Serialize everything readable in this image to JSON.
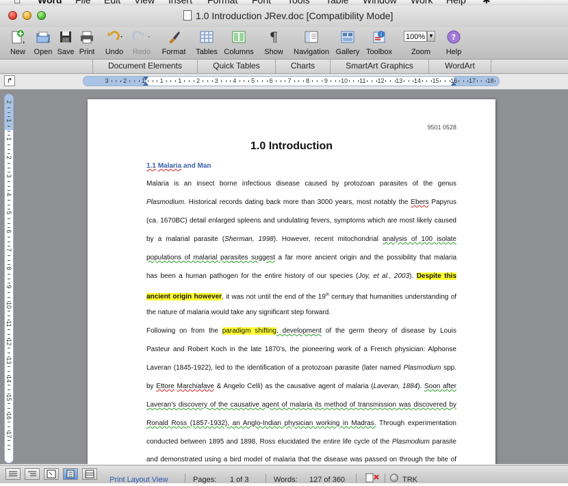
{
  "menubar": {
    "app": "Word",
    "items": [
      "File",
      "Edit",
      "View",
      "Insert",
      "Format",
      "Font",
      "Tools",
      "Table",
      "Window",
      "Work",
      "Help"
    ]
  },
  "window": {
    "title": "1.0 Introduction JRev.doc [Compatibility Mode]"
  },
  "toolbar": {
    "new": "New",
    "open": "Open",
    "save": "Save",
    "print": "Print",
    "undo": "Undo",
    "redo": "Redo",
    "format": "Format",
    "tables": "Tables",
    "columns": "Columns",
    "show": "Show",
    "navigation": "Navigation",
    "gallery": "Gallery",
    "toolbox": "Toolbox",
    "zoom": "Zoom",
    "zoom_value": "100%",
    "help": "Help"
  },
  "ribbon": {
    "tabs": [
      "Document Elements",
      "Quick Tables",
      "Charts",
      "SmartArt Graphics",
      "WordArt"
    ]
  },
  "ruler": {
    "numbers": [
      "3",
      "2",
      "1",
      "1",
      "1",
      "2",
      "3",
      "4",
      "5",
      "6",
      "7",
      "8",
      "9",
      "10",
      "11",
      "12",
      "13",
      "14",
      "15",
      "16",
      "17",
      "18"
    ]
  },
  "vruler": {
    "numbers": [
      "2",
      "1",
      "1",
      "2",
      "3",
      "4",
      "5",
      "6",
      "7",
      "8",
      "9",
      "10",
      "11",
      "12",
      "13",
      "14",
      "15",
      "16",
      "17"
    ]
  },
  "document": {
    "page_number": "9501 0528",
    "heading": "1.0 Introduction",
    "subheading_num": "1.1",
    "subheading_word1": "Malaria",
    "subheading_rest": " and Man",
    "p1": {
      "l1": "Malaria is an insect borne infectious disease caused by protozoan parasites of the genus",
      "l2_i": "Plasmodium",
      "l2_a": ".  Historical records dating back more than 3000 years, most notably the ",
      "l2_sp": "Ebers",
      "l2_b": " Papyrus",
      "l3": "(ca. 1670BC) detail enlarged spleens and undulating fevers, symptoms which are most likely caused",
      "l4_a": "by a malarial parasite (",
      "l4_i": "Sherman, 1998",
      "l4_b": ").  However, recent mitochondrial ",
      "l4_gr": "analysis of 100 isolate",
      "l5_gr": "populations of malarial parasites suggest",
      "l5_b": " a far more ancient origin and the possibility that malaria",
      "l6_a": "has been a human pathogen for the entire history of our species (",
      "l6_i": "Joy, et al., 2003",
      "l6_b": ").  ",
      "l6_hl": "Despite this",
      "l7_hl": "ancient origin however",
      "l7_a": ", it was not until the end of the 19",
      "l7_sup": "th",
      "l7_b": " century that humanities understanding of",
      "l8": "the nature of malaria would take any significant step forward."
    },
    "p2": {
      "l1_a": "Following on from the ",
      "l1_hl": "paradigm shifting",
      "l1_gr": ", development",
      "l1_b": " of the germ theory of disease by Louis",
      "l2": "Pasteur and Robert Koch in the late 1870’s, the pioneering work of a French physician: Alphonse",
      "l3_a": "Laveran (1845-1922), led to the identification of a protozoan parasite (later named ",
      "l3_i": "Plasmodium",
      "l3_b": " spp.",
      "l4_a": "by ",
      "l4_sp1": "Ettore",
      "l4_s": " ",
      "l4_sp2": "Marchiafave",
      "l4_b": " & Angelo Celli) as the causative agent of malaria (",
      "l4_i": "Laveran, 1884",
      "l4_c": ").  ",
      "l4_gr": "Soon after",
      "l5_gr": "Laveran’s discovery of the causative agent of malaria its method of transmission was discovered by",
      "l6_gr": "Ronald Ross (1857-1932), an Anglo-Indian physician working in Madras.",
      "l6_b": "  Through experimentation",
      "l7_a": "conducted between 1895 and 1898, Ross elucidated the entire life cycle of the ",
      "l7_i": "Plasmodium",
      "l7_b": " parasite",
      "l8": "and demonstrated using a bird model of malaria that the disease was passed on through the bite of"
    }
  },
  "statusbar": {
    "view": "Print Layout View",
    "pages_label": "Pages:",
    "pages_value": "1 of 3",
    "words_label": "Words:",
    "words_value": "127 of 360",
    "trk": "TRK"
  },
  "colors": {
    "highlight": "#ffff33",
    "subheading": "#3a5ea8",
    "spelling": "#d02020",
    "grammar": "#2a9d2a"
  }
}
